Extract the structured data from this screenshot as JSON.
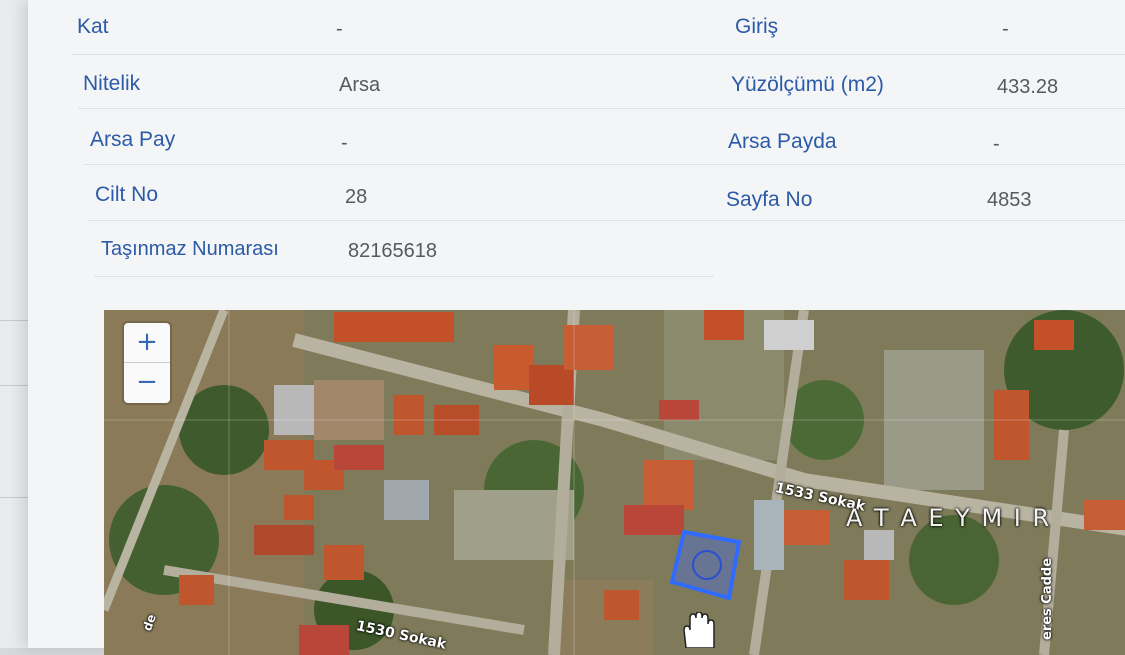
{
  "fields": {
    "kat_label": "Kat",
    "kat_value": "-",
    "giris_label": "Giriş",
    "giris_value": "-",
    "nitelik_label": "Nitelik",
    "nitelik_value": "Arsa",
    "yuzolcumu_label": "Yüzölçümü (m2)",
    "yuzolcumu_value": "433.28",
    "arsa_pay_label": "Arsa Pay",
    "arsa_pay_value": "-",
    "arsa_payda_label": "Arsa Payda",
    "arsa_payda_value": "-",
    "cilt_no_label": "Cilt No",
    "cilt_no_value": "28",
    "sayfa_no_label": "Sayfa No",
    "sayfa_no_value": "4853",
    "tasinmaz_label": "Taşınmaz Numarası",
    "tasinmaz_value": "82165618"
  },
  "map": {
    "zoom_in": "+",
    "zoom_out": "−",
    "street_1533": "1533 Sokak",
    "street_1530": "1530 Sokak",
    "district": "A T A E Y M I R",
    "cadde_right": "eres Cadde",
    "cadde_left": "de",
    "parcel_color": "#2f6bff",
    "cursor_icon": "hand-cursor-icon"
  }
}
